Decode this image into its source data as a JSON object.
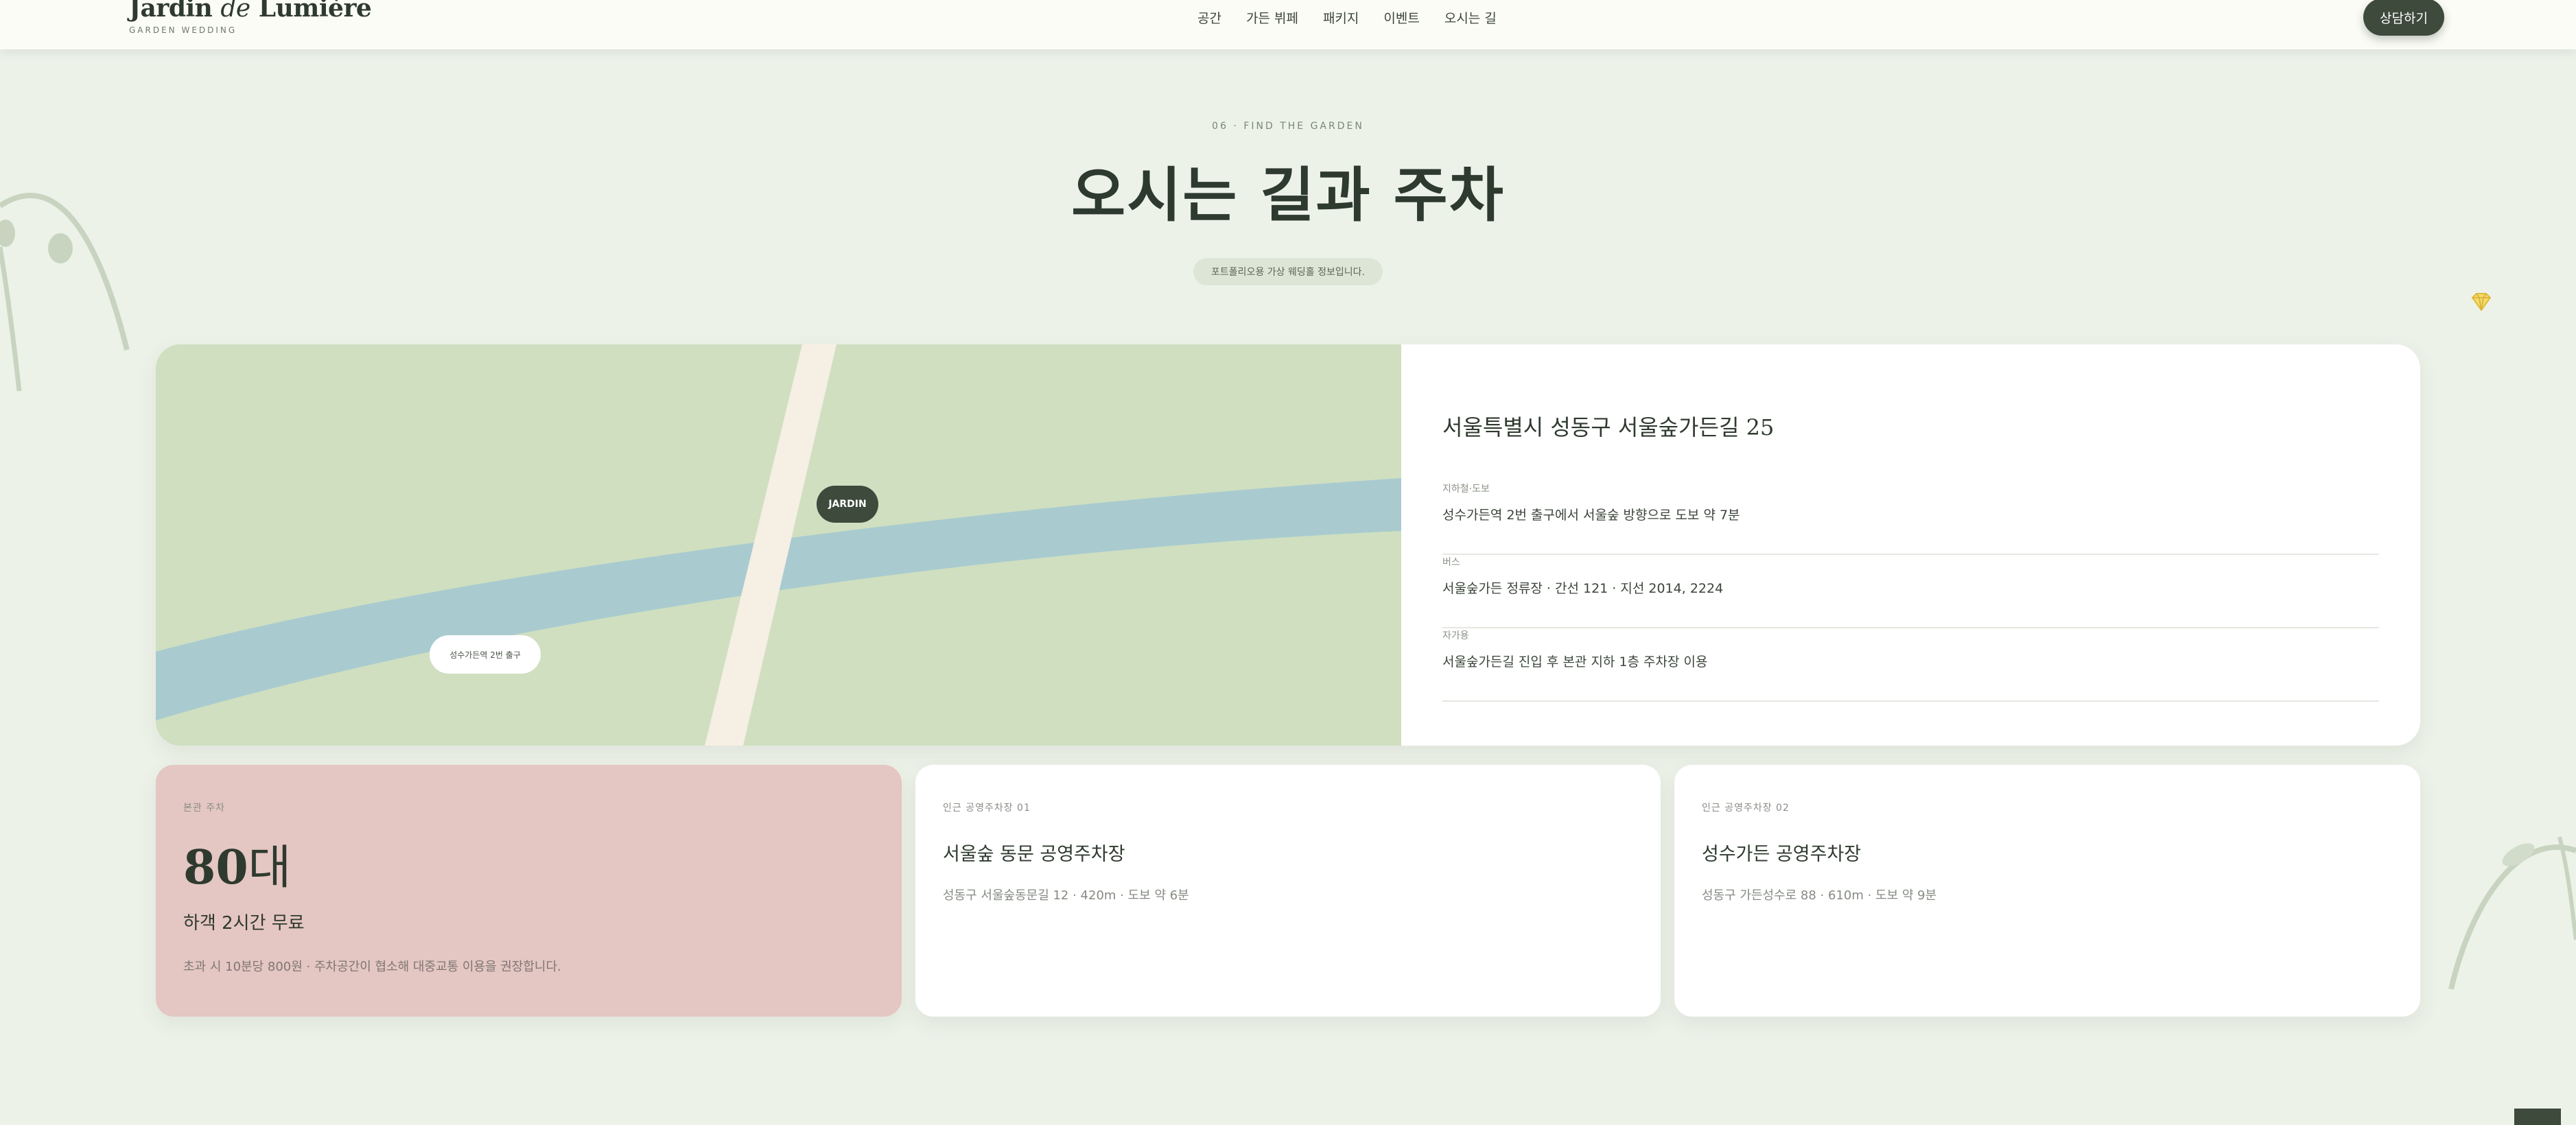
{
  "header": {
    "brand_main": "Jardin ",
    "brand_italic": "de",
    "brand_tail": " Lumière",
    "brand_sub": "GARDEN WEDDING",
    "nav": [
      "공간",
      "가든 뷔페",
      "패키지",
      "이벤트",
      "오시는 길"
    ],
    "cta_label": "상담하기"
  },
  "section": {
    "kicker": "06 · FIND THE GARDEN",
    "title": "오시는 길과 주차",
    "notice": "포트폴리오용 가상 웨딩홀 정보입니다."
  },
  "map": {
    "pin_label": "JARDIN",
    "station_label": "성수가든역 2번 출구"
  },
  "location": {
    "address": "서울특별시 성동구 서울숲가든길 25",
    "routes": [
      {
        "label": "지하철·도보",
        "desc": "성수가든역 2번 출구에서 서울숲 방향으로 도보 약 7분"
      },
      {
        "label": "버스",
        "desc": "서울숲가든 정류장 · 간선 121 · 지선 2014, 2224"
      },
      {
        "label": "자가용",
        "desc": "서울숲가든길 진입 후 본관 지하 1층 주차장 이용"
      }
    ]
  },
  "parking": {
    "own": {
      "kicker": "본관 주차",
      "count": "80",
      "unit": "대",
      "sub": "하객 2시간 무료",
      "note": "초과 시 10분당 800원 · 주차공간이 협소해 대중교통 이용을 권장합니다."
    },
    "nearby": [
      {
        "kicker": "인근 공영주차장 01",
        "name": "서울숲 동문 공영주차장",
        "meta": "성동구 서울숲동문길 12 · 420m · 도보 약 6분"
      },
      {
        "kicker": "인근 공영주차장 02",
        "name": "성수가든 공영주차장",
        "meta": "성동구 가든성수로 88 · 610m · 도보 약 9분"
      }
    ]
  },
  "colors": {
    "page_bg": "#edf2e9",
    "header_bg": "#fbfcf5",
    "accent_dark": "#3d4a3c",
    "map_green": "#cfdfc0",
    "map_river": "#a9cbd0",
    "map_road": "#f6efe4",
    "own_parking_bg": "#e4c6c2"
  }
}
